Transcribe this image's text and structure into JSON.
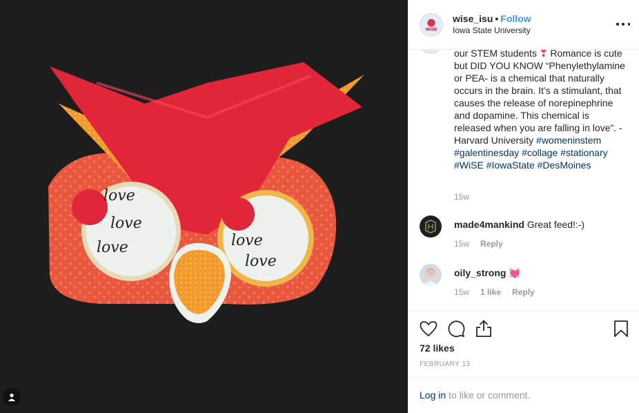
{
  "post": {
    "username": "wise_isu",
    "separator": "•",
    "follow_label": "Follow",
    "location": "Iowa State University",
    "avatar_label": "WiSE",
    "caption": {
      "part1": "our STEM students",
      "emoji": "❣",
      "part2": " Romance is cute but DID YOU KNOW “Phenylethylamine or PEA- is a chemical that naturally occurs in the brain. It’s a stimulant, that causes the release of norepinephrine and dopamine. This chemical is released when you are falling in love”.  - Harvard University ",
      "hashtags": [
        "#womeninstem",
        "#galentinesday",
        "#collage",
        "#stationary",
        "#WiSE",
        "#IowaState",
        "#DesMoines"
      ],
      "age": "15w"
    },
    "comments": [
      {
        "username": "made4mankind",
        "text": "Great feed!:-)",
        "age": "15w",
        "likes": "",
        "reply_label": "Reply"
      },
      {
        "username": "oily_strong",
        "text": "💓",
        "age": "15w",
        "likes": "1 like",
        "reply_label": "Reply"
      }
    ],
    "likes_text": "72 likes",
    "date": "FEBRUARY 13",
    "login_link": "Log in",
    "login_suffix": "to like or comment.",
    "image_text": "love",
    "icons": {
      "like": "heart-outline-icon",
      "comment": "speech-bubble-icon",
      "share": "share-icon",
      "save": "bookmark-icon",
      "more": "more-options-icon",
      "user_tag": "user-tag-icon"
    },
    "colors": {
      "follow": "#3897f0",
      "hashtag": "#003569",
      "meta": "#999999"
    }
  }
}
